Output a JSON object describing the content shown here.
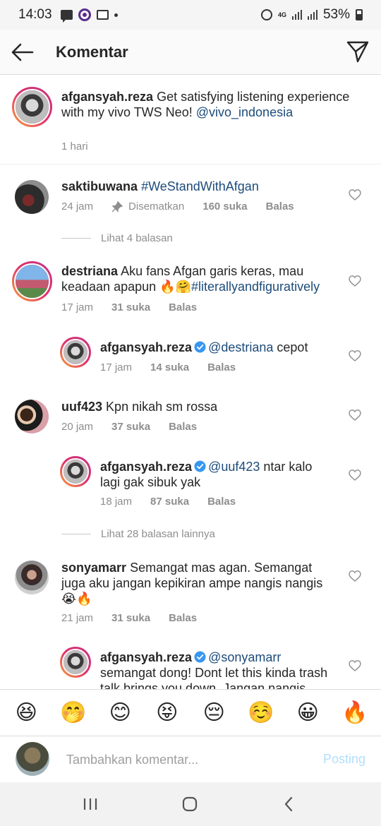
{
  "status_bar": {
    "time": "14:03",
    "network": "4G",
    "battery": "53%"
  },
  "header": {
    "title": "Komentar",
    "back_icon": "arrow-left-icon",
    "send_icon": "paper-plane-icon"
  },
  "caption": {
    "username": "afgansyah.reza",
    "text": "Get satisfying listening experience with my vivo TWS Neo!",
    "mention": "@vivo_indonesia",
    "time": "1 hari"
  },
  "comments": [
    {
      "username": "saktibuwana",
      "text_link": "#WeStandWithAfgan",
      "time": "24 jam",
      "pinned": "Disematkan",
      "likes": "160 suka",
      "reply": "Balas",
      "view_replies": "Lihat 4 balasan"
    },
    {
      "username": "destriana",
      "text": "Aku fans Afgan garis keras, mau keadaan apapun",
      "emojis": "🔥🤗",
      "text_link": "#literallyandfiguratively",
      "time": "17 jam",
      "likes": "31 suka",
      "reply": "Balas"
    },
    {
      "username": "afgansyah.reza",
      "mention": "@destriana",
      "text": "cepot",
      "time": "17 jam",
      "likes": "14 suka",
      "reply": "Balas"
    },
    {
      "username": "uuf423",
      "text": "Kpn nikah sm rossa",
      "time": "20 jam",
      "likes": "37 suka",
      "reply": "Balas"
    },
    {
      "username": "afgansyah.reza",
      "mention": "@uuf423",
      "text": "ntar kalo lagi gak sibuk yak",
      "time": "18 jam",
      "likes": "87 suka",
      "reply": "Balas",
      "view_replies": "Lihat 28 balasan lainnya"
    },
    {
      "username": "sonyamarr",
      "text": "Semangat mas agan. Semangat juga aku jangan kepikiran ampe nangis nangis",
      "emojis": "😭🔥",
      "time": "21 jam",
      "likes": "31 suka",
      "reply": "Balas"
    },
    {
      "username": "afgansyah.reza",
      "mention": "@sonyamarr",
      "text": "semangat dong! Dont let this kinda trash talk brings you down. Jangan nangis"
    }
  ],
  "emoji_bar": [
    "😆",
    "🤭",
    "😊",
    "😝",
    "😔",
    "☺️",
    "😀",
    "🔥"
  ],
  "composer": {
    "placeholder": "Tambahkan komentar...",
    "post_label": "Posting"
  },
  "colors": {
    "link": "#1c4b7a",
    "verified": "#3897f0",
    "post_disabled": "#b2dffc"
  }
}
